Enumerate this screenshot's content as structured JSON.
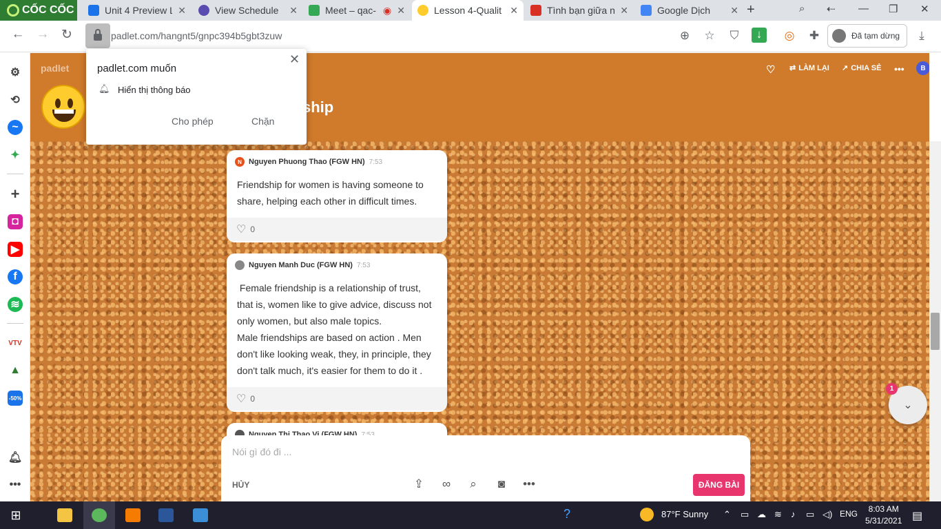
{
  "browser": {
    "brand": "CỐC CỐC",
    "tabs": [
      {
        "title": "Unit 4 Preview L"
      },
      {
        "title": "View Schedule"
      },
      {
        "title": "Meet – qac-"
      },
      {
        "title": "Lesson 4-Qualit"
      },
      {
        "title": "Tình bạn giữa n"
      },
      {
        "title": "Google Dịch"
      }
    ],
    "url": "padlet.com/hangnt5/gnpc394b5gbt3zuw",
    "profile_label": "Đã tạm dừng"
  },
  "notification_prompt": {
    "title": "padlet.com muốn",
    "message": "Hiển thị thông báo",
    "allow_label": "Cho phép",
    "block_label": "Chặn"
  },
  "padlet": {
    "logo": "padlet",
    "title_visible": "ship",
    "actions": {
      "remake": "LÀM LẠI",
      "share": "CHIA SẺ"
    },
    "avatar_initial": "B",
    "posts": [
      {
        "author": "Nguyen Phuong Thao (FGW HN)",
        "time": "7:53",
        "initial": "N",
        "text": "Friendship for women is having someone to share, helping each other in difficult times.",
        "likes": "0"
      },
      {
        "author": "Nguyen Manh Duc (FGW HN)",
        "time": "7:53",
        "initial": "",
        "text": " Female friendship is a relationship of trust, that is, women like to give advice, discuss not only women, but also male topics.\nMale friendships are based on action . Men don't like looking weak, they, in principle, they don't talk much, it's easier for them to do it .",
        "likes": "0"
      },
      {
        "author": "Nguyen Thi Thao Vi (FGW HN)",
        "time": "7:53",
        "initial": "",
        "text": "",
        "likes": ""
      }
    ],
    "notification_count": "1",
    "composer": {
      "placeholder": "Nói gì đó đi ...",
      "cancel_label": "HỦY",
      "post_label": "ĐĂNG BÀI"
    }
  },
  "taskbar": {
    "weather": "87°F  Sunny",
    "language": "ENG",
    "time": "8:03 AM",
    "date": "5/31/2021"
  }
}
